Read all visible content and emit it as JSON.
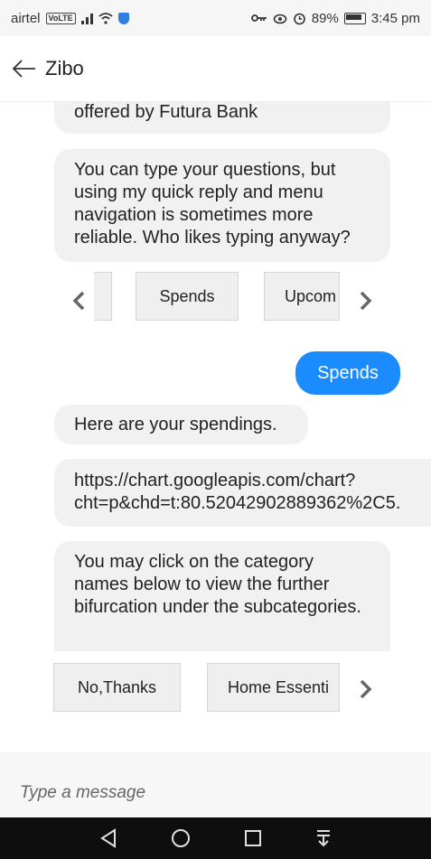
{
  "status_bar": {
    "carrier": "airtel",
    "volte": "VoLTE",
    "battery": "89%",
    "time": "3:45 pm"
  },
  "header": {
    "title": "Zibo"
  },
  "messages": {
    "m1": "offered by Futura Bank",
    "m2": "You can type your questions, but using my quick reply and menu navigation is sometimes more reliable. Who likes typing anyway?",
    "user1": "Spends",
    "m3": "Here are your spendings.",
    "m4_line1": "https://chart.googleapis.com/chart?",
    "m4_line2": "cht=p&chd=t:80.52042902889362%2C5.",
    "m5": "You may click on the category names below to view the further bifurcation under the subcategories."
  },
  "quick_replies_1": {
    "first": "Spends",
    "second": "Upcom"
  },
  "quick_replies_2": {
    "first": "No,Thanks",
    "second": "Home Essenti"
  },
  "input": {
    "placeholder": "Type a message"
  },
  "colors": {
    "user_bubble": "#1a8cff",
    "bot_bubble": "#f1f1f1",
    "navbar": "#0e0e0e"
  }
}
